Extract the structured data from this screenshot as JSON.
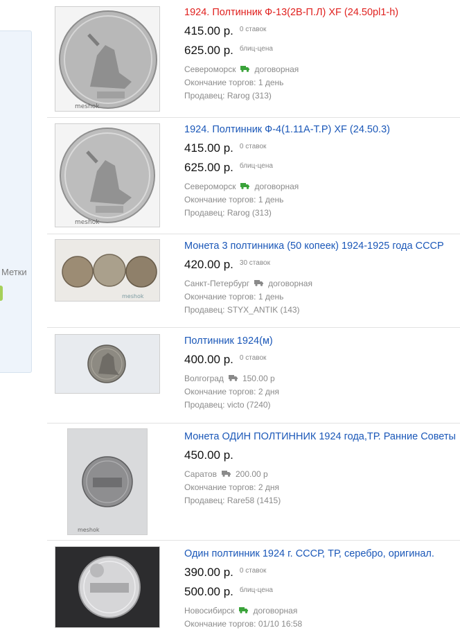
{
  "sidebar": {
    "label": "Метки"
  },
  "colors": {
    "link": "#1a57b8",
    "link_red": "#e0201e",
    "truck_green": "#3aa33a",
    "truck_gray": "#8a8a8a",
    "sidebar_bg": "#eef4fb",
    "sidebar_button": "#a6d05a"
  },
  "listings": [
    {
      "title": "1924. Полтинник Ф-13(2В-П.Л) XF (24.50pl1-h)",
      "title_color": "red",
      "price": "415.00 р.",
      "price_note": "0 ставок",
      "blitz_price": "625.00 р.",
      "blitz_note": "блиц-цена",
      "city": "Североморск",
      "truck_icon": "truck-icon-green",
      "delivery": "договорная",
      "ends": "Окончание торгов: 1 день",
      "seller": "Продавец: Rarog (313)",
      "watermark": "meshok"
    },
    {
      "title": "1924. Полтинник Ф-4(1.11А-Т.Р) XF (24.50.3)",
      "title_color": "blue",
      "price": "415.00 р.",
      "price_note": "0 ставок",
      "blitz_price": "625.00 р.",
      "blitz_note": "блиц-цена",
      "city": "Североморск",
      "truck_icon": "truck-icon-green",
      "delivery": "договорная",
      "ends": "Окончание торгов: 1 день",
      "seller": "Продавец: Rarog (313)",
      "watermark": "meshok"
    },
    {
      "title": "Монета 3 полтинника (50 копеек) 1924-1925 года СССР",
      "title_color": "blue",
      "price": "420.00 р.",
      "price_note": "30 ставок",
      "city": "Санкт-Петербург",
      "truck_icon": "truck-icon-gray",
      "delivery": "договорная",
      "ends": "Окончание торгов: 1 день",
      "seller": "Продавец: STYX_ANTIK (143)",
      "watermark": "meshok"
    },
    {
      "title": "Полтинник 1924(м)",
      "title_color": "blue",
      "price": "400.00 р.",
      "price_note": "0 ставок",
      "city": "Волгоград",
      "truck_icon": "truck-icon-gray",
      "delivery": "150.00 р",
      "ends": "Окончание торгов: 2 дня",
      "seller": "Продавец: victo (7240)"
    },
    {
      "title": "Монета ОДИН ПОЛТИННИК 1924 года,ТР. Ранние Советы",
      "title_color": "blue",
      "price": "450.00 р.",
      "city": "Саратов",
      "truck_icon": "truck-icon-gray",
      "delivery": "200.00 р",
      "ends": "Окончание торгов: 2 дня",
      "seller": "Продавец: Rare58 (1415)",
      "watermark": "meshok"
    },
    {
      "title": "Один полтинник 1924 г. СССР, ТР, серебро, оригинал.",
      "title_color": "blue",
      "price": "390.00 р.",
      "price_note": "0 ставок",
      "blitz_price": "500.00 р.",
      "blitz_note": "блиц-цена",
      "city": "Новосибирск",
      "truck_icon": "truck-icon-green",
      "delivery": "договорная",
      "ends": "Окончание торгов: 01/10 16:58"
    }
  ]
}
